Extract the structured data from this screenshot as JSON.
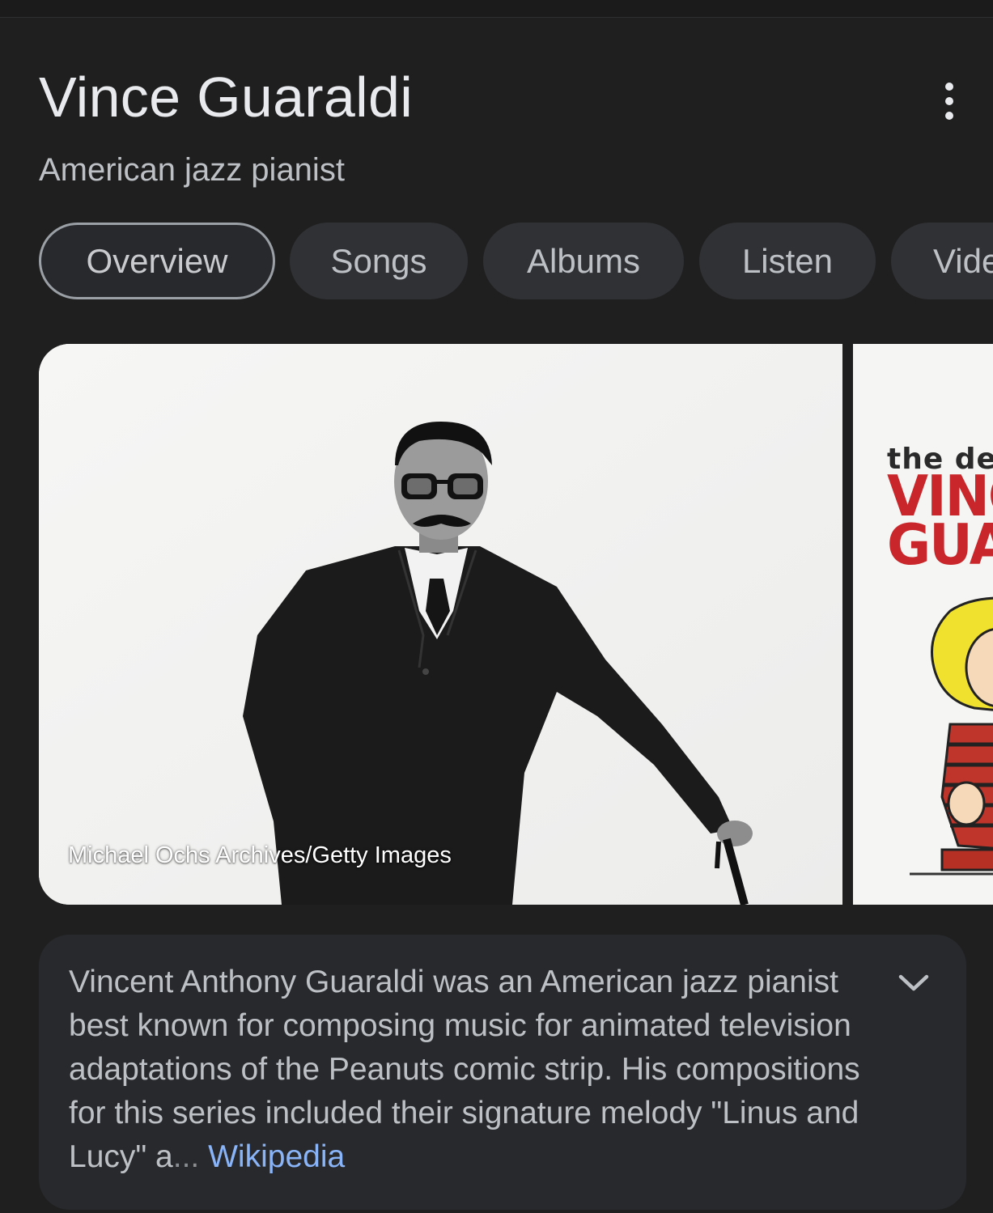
{
  "header": {
    "title": "Vince Guaraldi",
    "subtitle": "American jazz pianist",
    "more_icon": "more-vert-icon"
  },
  "tabs": [
    {
      "label": "Overview",
      "active": true
    },
    {
      "label": "Songs",
      "active": false
    },
    {
      "label": "Albums",
      "active": false
    },
    {
      "label": "Listen",
      "active": false
    },
    {
      "label": "Videos",
      "active": false
    }
  ],
  "gallery": {
    "main_image": {
      "credit": "Michael Ochs Archives/Getty Images"
    },
    "second_image": {
      "line1": "the definitive",
      "line2": "VINCE",
      "line3": "GUARALDI"
    }
  },
  "description": {
    "text": "Vincent Anthony Guaraldi was an American jazz pianist best known for composing music for animated television adaptations of the Peanuts comic strip. His compositions for this series included their signature melody \"Linus and Lucy\" a",
    "fade_tail": "...",
    "source_link": "Wikipedia",
    "expand_icon": "chevron-down-icon"
  },
  "colors": {
    "background": "#1f1f1f",
    "chip": "#303134",
    "card": "#28292c",
    "link": "#8ab4f8",
    "album_red": "#c8262a"
  }
}
